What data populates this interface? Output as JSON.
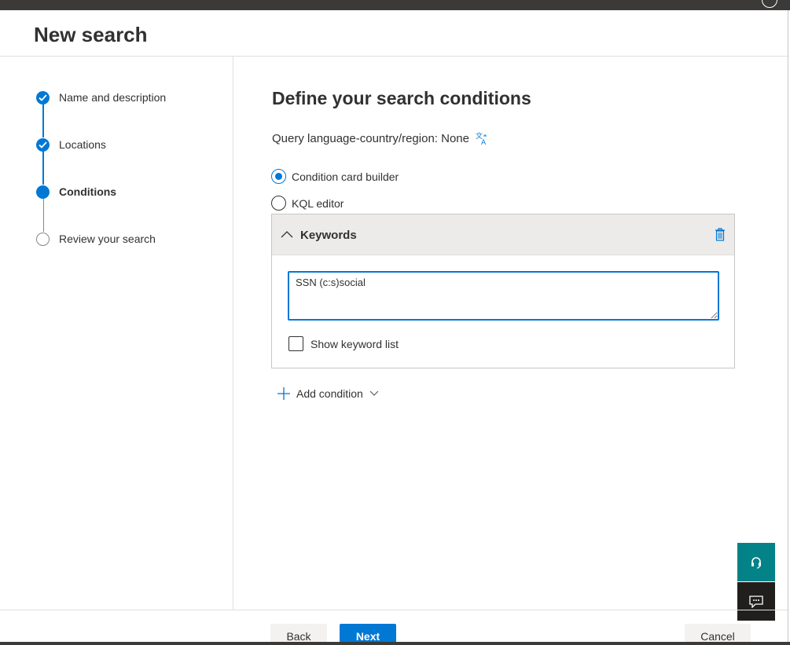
{
  "page": {
    "title": "New search"
  },
  "colors": {
    "accent": "#0078d4",
    "help_bg": "#038387",
    "feedback_bg": "#201f1e"
  },
  "steps": [
    {
      "label": "Name and description",
      "state": "done"
    },
    {
      "label": "Locations",
      "state": "done"
    },
    {
      "label": "Conditions",
      "state": "current"
    },
    {
      "label": "Review your search",
      "state": "todo"
    }
  ],
  "main": {
    "heading": "Define your search conditions",
    "query_language": "Query language-country/region: None",
    "mode_options": [
      {
        "label": "Condition card builder",
        "selected": true
      },
      {
        "label": "KQL editor",
        "selected": false
      }
    ],
    "card": {
      "title": "Keywords",
      "keywords_value": "SSN (c:s)social",
      "show_keyword_list_label": "Show keyword list",
      "show_keyword_list_checked": false
    },
    "add_condition_label": "Add condition"
  },
  "footer": {
    "back_label": "Back",
    "next_label": "Next",
    "cancel_label": "Cancel"
  },
  "icons": {
    "translate": "translate-icon",
    "trash": "trash-icon",
    "help": "headset-icon",
    "feedback": "feedback-icon"
  }
}
